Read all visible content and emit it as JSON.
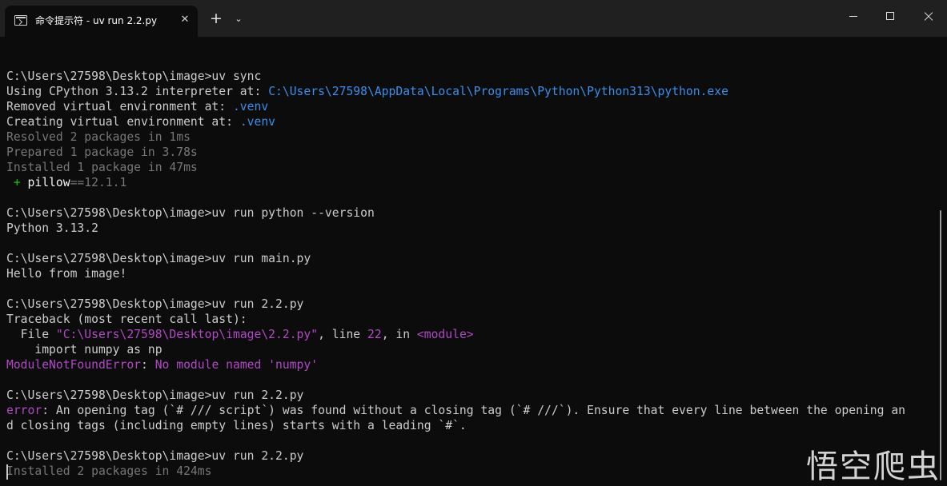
{
  "window": {
    "tab_title": "命令提示符 - uv  run 2.2.py",
    "tab_close_glyph": "✕",
    "new_tab_glyph": "+",
    "dropdown_glyph": "⌄"
  },
  "terminal": {
    "lines": [
      {
        "parts": [
          {
            "text": "",
            "cls": ""
          }
        ]
      },
      {
        "parts": [
          {
            "text": "C:\\Users\\27598\\Desktop\\image>uv sync",
            "cls": ""
          }
        ]
      },
      {
        "parts": [
          {
            "text": "Using CPython 3.13.2 interpreter at: ",
            "cls": ""
          },
          {
            "text": "C:\\Users\\27598\\AppData\\Local\\Programs\\Python\\Python313\\python.exe",
            "cls": "blue"
          }
        ]
      },
      {
        "parts": [
          {
            "text": "Removed virtual environment at: ",
            "cls": ""
          },
          {
            "text": ".venv",
            "cls": "blue"
          }
        ]
      },
      {
        "parts": [
          {
            "text": "Creating virtual environment at: ",
            "cls": ""
          },
          {
            "text": ".venv",
            "cls": "blue"
          }
        ]
      },
      {
        "parts": [
          {
            "text": "Resolved 2 packages in 1ms",
            "cls": "gray"
          }
        ]
      },
      {
        "parts": [
          {
            "text": "Prepared 1 package in 3.78s",
            "cls": "gray"
          }
        ]
      },
      {
        "parts": [
          {
            "text": "Installed 1 package in 47ms",
            "cls": "gray"
          }
        ]
      },
      {
        "parts": [
          {
            "text": " + ",
            "cls": "green"
          },
          {
            "text": "pillow",
            "cls": "white"
          },
          {
            "text": "==12.1.1",
            "cls": "gray"
          }
        ]
      },
      {
        "parts": [
          {
            "text": "",
            "cls": ""
          }
        ]
      },
      {
        "parts": [
          {
            "text": "C:\\Users\\27598\\Desktop\\image>uv run python --version",
            "cls": ""
          }
        ]
      },
      {
        "parts": [
          {
            "text": "Python 3.13.2",
            "cls": ""
          }
        ]
      },
      {
        "parts": [
          {
            "text": "",
            "cls": ""
          }
        ]
      },
      {
        "parts": [
          {
            "text": "C:\\Users\\27598\\Desktop\\image>uv run main.py",
            "cls": ""
          }
        ]
      },
      {
        "parts": [
          {
            "text": "Hello from image!",
            "cls": ""
          }
        ]
      },
      {
        "parts": [
          {
            "text": "",
            "cls": ""
          }
        ]
      },
      {
        "parts": [
          {
            "text": "C:\\Users\\27598\\Desktop\\image>uv run 2.2.py",
            "cls": ""
          }
        ]
      },
      {
        "parts": [
          {
            "text": "Traceback (most recent call last):",
            "cls": ""
          }
        ]
      },
      {
        "parts": [
          {
            "text": "  File ",
            "cls": ""
          },
          {
            "text": "\"C:\\Users\\27598\\Desktop\\image\\2.2.py\"",
            "cls": "purple"
          },
          {
            "text": ", line ",
            "cls": ""
          },
          {
            "text": "22",
            "cls": "purple"
          },
          {
            "text": ", in ",
            "cls": ""
          },
          {
            "text": "<module>",
            "cls": "purple"
          }
        ]
      },
      {
        "parts": [
          {
            "text": "    import numpy as np",
            "cls": ""
          }
        ]
      },
      {
        "parts": [
          {
            "text": "ModuleNotFoundError",
            "cls": "purple"
          },
          {
            "text": ": ",
            "cls": ""
          },
          {
            "text": "No module named 'numpy'",
            "cls": "purple"
          }
        ]
      },
      {
        "parts": [
          {
            "text": "",
            "cls": ""
          }
        ]
      },
      {
        "parts": [
          {
            "text": "C:\\Users\\27598\\Desktop\\image>uv run 2.2.py",
            "cls": ""
          }
        ]
      },
      {
        "parts": [
          {
            "text": "error",
            "cls": "purple"
          },
          {
            "text": ": An opening tag (`# /// script`) was found without a closing tag (`# ///`). Ensure that every line between the opening an",
            "cls": ""
          }
        ]
      },
      {
        "parts": [
          {
            "text": "d closing tags (including empty lines) starts with a leading `#`.",
            "cls": ""
          }
        ]
      },
      {
        "parts": [
          {
            "text": "",
            "cls": ""
          }
        ]
      },
      {
        "parts": [
          {
            "text": "C:\\Users\\27598\\Desktop\\image>uv run 2.2.py",
            "cls": ""
          }
        ]
      },
      {
        "parts": [
          {
            "text": "Installed 2 packages in 424ms",
            "cls": "gray"
          }
        ]
      }
    ]
  },
  "watermark": "悟空爬虫",
  "colors": {
    "background": "#0c0c0c",
    "titlebar": "#202020",
    "foreground": "#cccccc",
    "blue": "#3b8eea",
    "purple": "#b148c6",
    "green": "#16c60c",
    "gray": "#767676"
  }
}
